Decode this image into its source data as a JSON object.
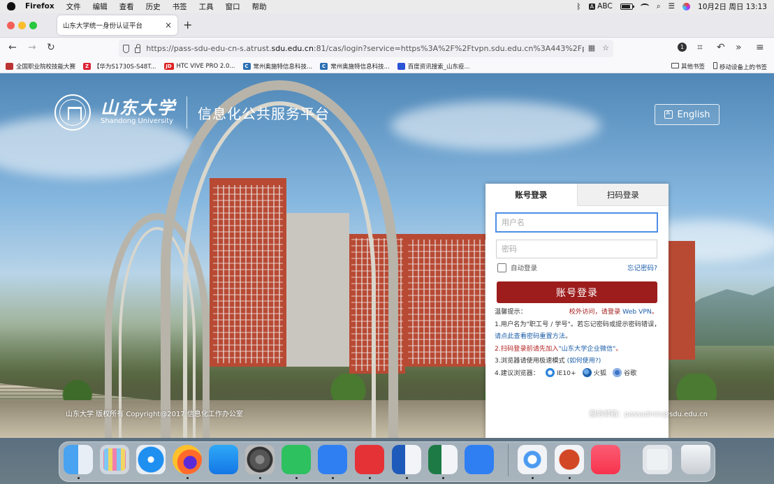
{
  "menubar": {
    "app_name": "Firefox",
    "items": [
      "文件",
      "编辑",
      "查看",
      "历史",
      "书签",
      "工具",
      "窗口",
      "帮助"
    ],
    "input_method": "ABC",
    "datetime": "10月2日 周日  13:13",
    "status_icons": [
      "bluetooth-icon",
      "input-method-icon",
      "battery-icon",
      "wifi-icon",
      "spotlight-icon",
      "control-center-icon",
      "siri-icon"
    ]
  },
  "browser": {
    "tab_title": "山东大学统一身份认证平台",
    "tab_close": "×",
    "new_tab": "+",
    "url_prefix": "https://pass-sdu-edu-cn-s.atrust.",
    "url_host": "sdu.edu.cn",
    "url_suffix": ":81/cas/login?service=https%3A%2F%2Ftvpn.sdu.edu.cn%3A443%2Fpasspo",
    "nav_icons": [
      "back-icon",
      "forward-icon",
      "reload-icon",
      "qr-icon",
      "bookmark-star-icon",
      "account-icon",
      "screenshot-icon",
      "undo-icon",
      "overflow-icon",
      "menu-icon"
    ],
    "account_badge": "1",
    "bookmarks": [
      {
        "label": "全国职业院校技能大赛",
        "fav": "",
        "color": "#b33"
      },
      {
        "label": "【华为S1730S-S48T...",
        "fav": "Z",
        "color": "#d23"
      },
      {
        "label": "HTC VIVE PRO 2.0...",
        "fav": "JD",
        "color": "#d22"
      },
      {
        "label": "常州奥施特信息科技...",
        "fav": "C",
        "color": "#2a6fb3"
      },
      {
        "label": "常州奥施特信息科技...",
        "fav": "C",
        "color": "#2a6fb3"
      },
      {
        "label": "百度资讯搜索_山东疫...",
        "fav": "",
        "color": "#2f4fd8"
      }
    ],
    "bookmarks_right": [
      "其他书签",
      "移动设备上的书签"
    ]
  },
  "page": {
    "uni_name_cn": "山东大学",
    "uni_name_en": "Shandong University",
    "platform_title": "信息化公共服务平台",
    "language_button": "English",
    "footer_copyright": "山东大学 版权所有 Copyright@2017   信息化工作办公室",
    "footer_email": "服务邮箱：passadmin@sdu.edu.cn"
  },
  "login": {
    "tab_account": "账号登录",
    "tab_qr": "扫码登录",
    "username_placeholder": "用户名",
    "password_placeholder": "密码",
    "auto_login": "自动登录",
    "forgot_password": "忘记密码?",
    "submit": "账号登录",
    "tips_title": "温馨提示：",
    "tips_vpn_prefix": "校外访问，请登录 ",
    "tips_vpn_link": "Web VPN",
    "tips_vpn_suffix": "。",
    "tip1_text": "1.用户名为\"职工号 / 学号\"。若忘记密码或提示密码错误，",
    "tip1_link": "请点此查看密码重置方法",
    "tip1_end": "。",
    "tip2_prefix": "2.扫码登录前请先加入",
    "tip2_link": "\"山东大学企业微信\"",
    "tip2_end": "。",
    "tip3_text": "3.浏览器请使用极速模式 ",
    "tip3_link": "(如何使用?)",
    "tip4_prefix": "4.建议浏览器：",
    "browser_ie": "IE10+",
    "browser_firefox": "火狐",
    "browser_chrome": "谷歌"
  },
  "dock": {
    "apps": [
      "finder-icon",
      "launchpad-icon",
      "safari-icon",
      "firefox-icon",
      "app-store-icon",
      "system-preferences-icon",
      "wechat-icon",
      "lark-icon",
      "netease-music-icon",
      "word-icon",
      "excel-icon",
      "feishu-icon",
      "baidu-netdisk-icon",
      "powerpoint-icon",
      "music-icon",
      "downloads-stack-icon",
      "trash-icon"
    ]
  }
}
